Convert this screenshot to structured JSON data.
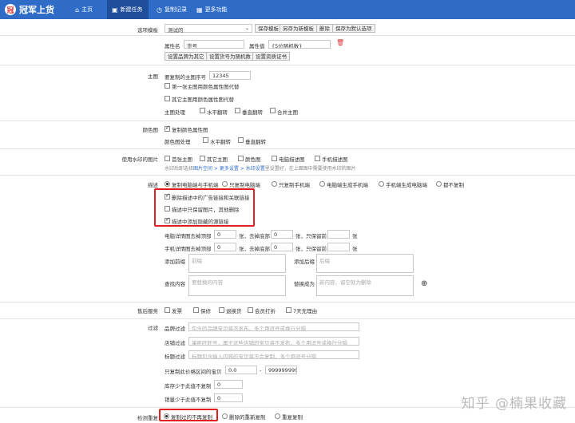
{
  "app": {
    "title": "冠军上货"
  },
  "tabs": [
    {
      "label": "主页",
      "icon": "home-icon"
    },
    {
      "label": "新建任务",
      "icon": "new-task-icon"
    },
    {
      "label": "复制记录",
      "icon": "record-icon"
    },
    {
      "label": "更多功能",
      "icon": "more-icon"
    }
  ],
  "template": {
    "label": "选项模板",
    "selected": "测试的",
    "buttons": [
      "保存模板",
      "另存为新模板",
      "删除",
      "保存为默认选项"
    ]
  },
  "attr": {
    "name_label": "属性名",
    "name_value": "货号",
    "value_label": "属性值",
    "value_value": "{5位随机数}",
    "buttons": [
      "设置品牌为其它",
      "设置货号为随机数",
      "设置资质证书"
    ]
  },
  "main_image": {
    "label": "主图",
    "seq_label": "要复制的主图序号",
    "seq_value": "12345",
    "opt1": "第一张主图用颜色属性图代替",
    "opt2": "其它主图用颜色属性图代替",
    "process_label": "主图处理",
    "flips": [
      "水平翻转",
      "垂直翻转",
      "合并主图"
    ]
  },
  "color_image": {
    "label": "颜色图",
    "opt": "复制颜色属性图",
    "process_label": "颜色图处理",
    "flips": [
      "水平翻转",
      "垂直翻转"
    ]
  },
  "watermark": {
    "label": "使用水印的图片",
    "items": [
      "首张主图",
      "其它主图",
      "颜色图",
      "电脑描述图",
      "手机描述图"
    ],
    "hint_pre": "水印后即选择",
    "hint_link": "图片空间 > 更多设置 > 水印设置",
    "hint_post": "里设置好，在上面图中需要使用水印的图片"
  },
  "desc": {
    "label": "描述",
    "radios": [
      "复制电脑端与手机端",
      "只复制电脑端",
      "只复制手机端",
      "电脑端生成手机端",
      "手机端生成电脑端",
      "都不复制"
    ],
    "checks": [
      "删除描述中的广告链接和关联链接",
      "描述中只保留图片，其他删除",
      "描述中添加隐藏的源链接"
    ],
    "pc_label": "电脑详情图去掉顶部",
    "pc_top": "0",
    "pc_mid": "张，去掉底部",
    "pc_bottom": "0",
    "pc_keep": "张，只保留前",
    "pc_end": "张",
    "m_label": "手机详情图去掉顶部",
    "m_top": "0",
    "m_mid": "张，去掉底部",
    "m_bottom": "0",
    "m_keep": "张，只保留前",
    "m_end": "张",
    "prefix_label": "添加前缀",
    "prefix_ph": "前缀",
    "suffix_label": "添加后缀",
    "suffix_ph": "后缀",
    "find_label": "查找内容",
    "find_ph": "要替换的内容",
    "replace_label": "替换成为",
    "replace_ph": "新内容，留空就为删除"
  },
  "service": {
    "label": "售后服务",
    "items": [
      "发票",
      "保修",
      "退换货",
      "会员打折",
      "7天无理由"
    ]
  },
  "filter": {
    "label": "过滤",
    "brand_label": "品牌过滤",
    "brand_ph": "包含的品牌宝贝将不发布，多个用逗号或换行分隔",
    "shop_label": "店铺过滤",
    "shop_ph": "掌柜旺旺号，属于这些店铺的宝贝将不发布，多个用逗号或换行分隔",
    "title_label": "标题过滤",
    "title_ph": "标题包含输入内容的宝贝将不会复制，多个用逗号分隔",
    "price_label": "只复制此价格区间的宝贝",
    "price_min": "0.0",
    "price_sep": "-",
    "price_max": "999999999",
    "stock_label": "库存少于此值不复制",
    "stock_val": "0",
    "sales_label": "销量少于此值不复制",
    "sales_val": "0"
  },
  "dup": {
    "label": "检测重复",
    "radios": [
      "复制过的不再复制",
      "删除的重新复制",
      "重复复制"
    ]
  },
  "watermark_text": "知乎 @楠果收藏"
}
